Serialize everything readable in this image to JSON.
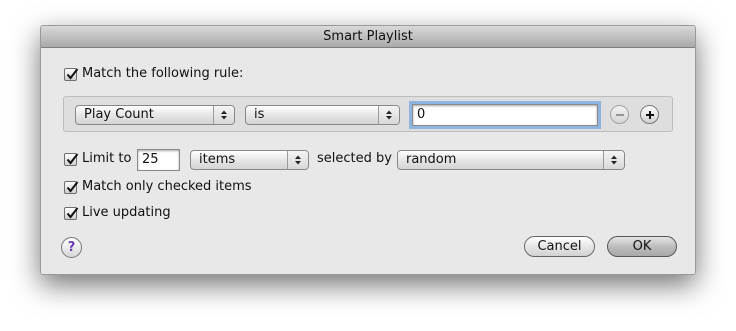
{
  "window": {
    "title": "Smart Playlist"
  },
  "rule_header": {
    "checked": true,
    "label": "Match the following rule:"
  },
  "rule": {
    "field": "Play Count",
    "operator": "is",
    "value": "0",
    "remove_symbol": "−",
    "add_symbol": "+"
  },
  "limit": {
    "checked": true,
    "label": "Limit to",
    "count": "25",
    "unit": "items",
    "selected_by_label": "selected by",
    "selected_by": "random"
  },
  "match_checked": {
    "checked": true,
    "label": "Match only checked items"
  },
  "live_updating": {
    "checked": true,
    "label": "Live updating"
  },
  "buttons": {
    "help": "?",
    "cancel": "Cancel",
    "ok": "OK"
  }
}
